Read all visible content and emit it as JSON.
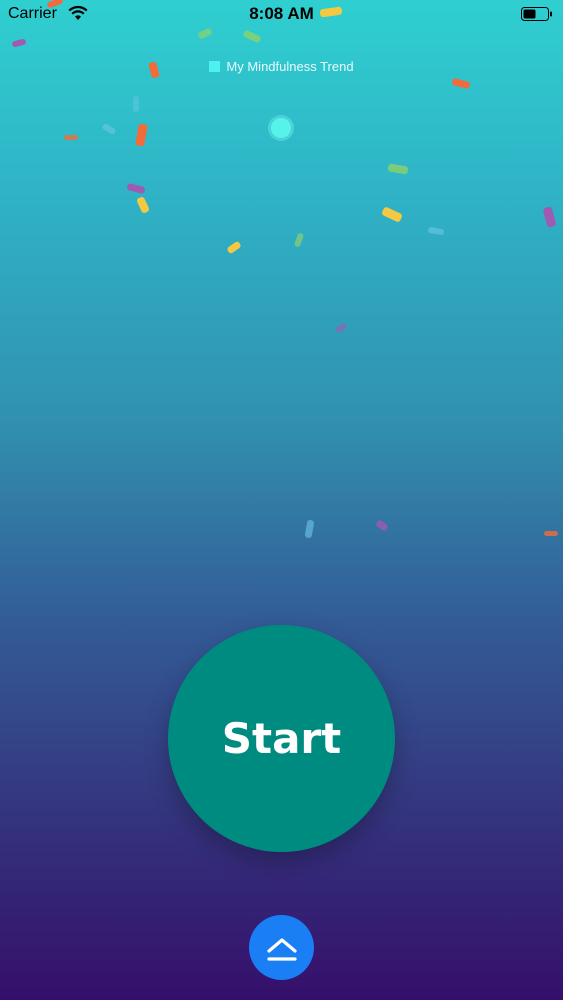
{
  "status_bar": {
    "carrier": "Carrier",
    "time": "8:08 AM",
    "icons": [
      "wifi-icon",
      "battery-icon"
    ]
  },
  "trend": {
    "legend_label": "My Mindfulness Trend",
    "swatch_color": "#4ff0f0",
    "marker_color": "#56f3e8"
  },
  "main": {
    "start_label": "Start",
    "start_color": "#008b80"
  },
  "footer": {
    "expand_icon": "chevron-up-bar-icon",
    "expand_color": "#1a7ff5"
  },
  "colors": {
    "gradient_top": "#2fcfd0",
    "gradient_bottom": "#350f6b",
    "confetti": [
      "#f26b3a",
      "#f5c842",
      "#8fd16a",
      "#a05ab0",
      "#6ec6e6"
    ]
  }
}
